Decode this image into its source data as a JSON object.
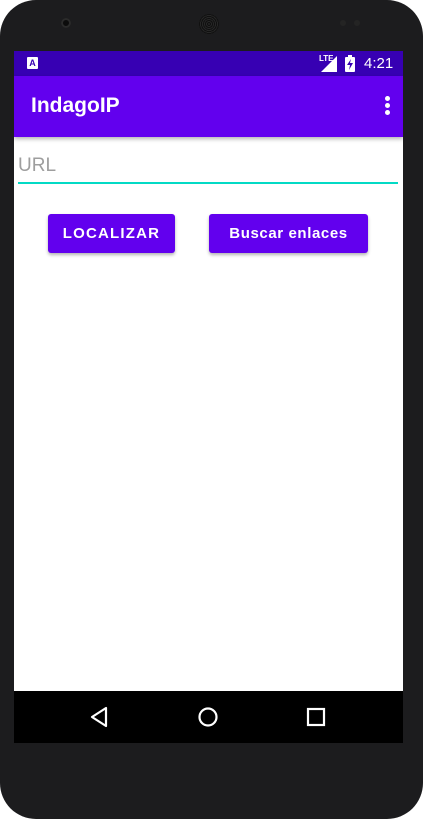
{
  "status_bar": {
    "notification_icon": "A",
    "network_label": "LTE",
    "time": "4:21"
  },
  "app_bar": {
    "title": "IndagoIP",
    "menu_icon": "more-vert-icon"
  },
  "url_input": {
    "placeholder": "URL",
    "value": ""
  },
  "buttons": {
    "localizar_label": "LOCALIZAR",
    "buscar_label": "Buscar enlaces"
  },
  "nav_bar": {
    "back_icon": "back-triangle-icon",
    "home_icon": "home-circle-icon",
    "recents_icon": "recents-square-icon"
  },
  "colors": {
    "primary": "#6200ee",
    "primary_dark": "#3700b3",
    "accent": "#03dac5"
  }
}
